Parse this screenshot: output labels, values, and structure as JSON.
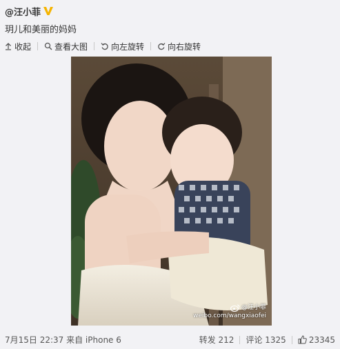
{
  "post": {
    "author": "@汪小菲",
    "verified_icon": "verified-v-icon",
    "text": "玥儿和美丽的妈妈",
    "toolbar": {
      "collapse": "收起",
      "view_large": "查看大图",
      "rotate_left": "向左旋转",
      "rotate_right": "向右旋转"
    },
    "image": {
      "description_icon": "photo-mother-and-child",
      "watermark_name": "@汪小菲",
      "watermark_url": "weibo.com/wangxiaofei"
    },
    "meta": "7月15日 22:37 来自 iPhone 6",
    "actions": {
      "repost": "转发 212",
      "comment": "评论 1325",
      "likes": "23345"
    }
  },
  "colors": {
    "background": "#f2f2f5",
    "verified": "#f5b400",
    "text": "#333333"
  }
}
